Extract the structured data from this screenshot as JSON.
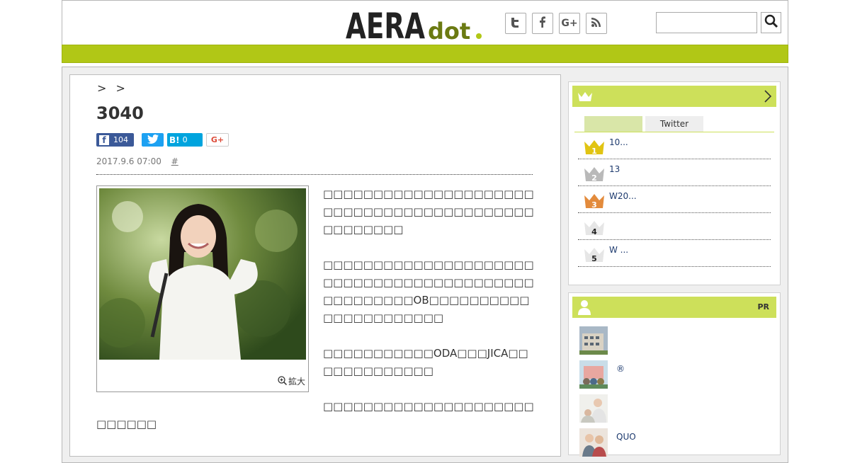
{
  "header": {
    "logo_main": "AERA",
    "logo_sub": "dot",
    "social": [
      "twitter-icon",
      "facebook-icon",
      "googleplus-icon",
      "rss-icon"
    ],
    "search": {
      "value": "",
      "placeholder": ""
    }
  },
  "colors": {
    "accent": "#b1c716",
    "sidebar_head": "#cde05a",
    "link": "#1d3a6e"
  },
  "article": {
    "breadcrumb": [
      ">",
      ">"
    ],
    "title": "3040",
    "share": {
      "facebook_count": "104",
      "hatena_label": "B!",
      "hatena_count": "0",
      "googleplus_label": "G+"
    },
    "date": "2017.9.6 07:00",
    "hashtag": "#",
    "photo_zoom_label": "拡大",
    "paragraphs": [
      "□□□□□□□□□□□□□□□□□□□□□□□□□□□□□□□□□□□□□□□□□□□□□□□□□□",
      "□□□□□□□□□□□□□□□□□□□□□□□□□□□□□□□□□□□□□□□□□□□□□□□□□□□OB□□□□□□□□□□□□□□□□□□□□□□",
      "□□□□□□□□□□□ODA□□□JICA□□□□□□□□□□□□□",
      "□□□□□□□□□□□□□□□□□□□□□□□□□□□"
    ]
  },
  "sidebar": {
    "ranking": {
      "tabs": [
        "",
        "Twitter"
      ],
      "items": [
        {
          "rank": "1",
          "text": "10..."
        },
        {
          "rank": "2",
          "text": "13"
        },
        {
          "rank": "3",
          "text": "W20..."
        },
        {
          "rank": "4",
          "text": ""
        },
        {
          "rank": "5",
          "text": "W ..."
        }
      ]
    },
    "pr": {
      "label": "PR",
      "items": [
        {
          "text": ""
        },
        {
          "text": "®"
        },
        {
          "text": ""
        },
        {
          "text": "QUO"
        }
      ]
    }
  }
}
